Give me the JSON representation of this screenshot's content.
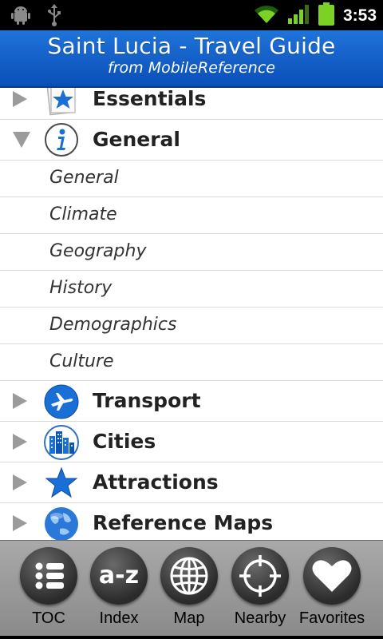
{
  "status_bar": {
    "time": "3:53",
    "icons": [
      "android-debug-icon",
      "usb-icon",
      "wifi-icon",
      "signal-icon",
      "battery-icon"
    ]
  },
  "header": {
    "title": "Saint Lucia - Travel Guide",
    "subtitle": "from MobileReference"
  },
  "toc": {
    "categories": [
      {
        "label": "Essentials",
        "icon": "star-document-icon",
        "expanded": false
      },
      {
        "label": "General",
        "icon": "info-icon",
        "expanded": true,
        "children": [
          "General",
          "Climate",
          "Geography",
          "History",
          "Demographics",
          "Culture"
        ]
      },
      {
        "label": "Transport",
        "icon": "airplane-icon",
        "expanded": false
      },
      {
        "label": "Cities",
        "icon": "city-buildings-icon",
        "expanded": false
      },
      {
        "label": "Attractions",
        "icon": "star-icon",
        "expanded": false
      },
      {
        "label": "Reference Maps",
        "icon": "globe-icon",
        "expanded": false
      }
    ]
  },
  "toolbar": {
    "items": [
      {
        "label": "TOC",
        "icon": "list-icon"
      },
      {
        "label": "Index",
        "icon": "a-z-icon"
      },
      {
        "label": "Map",
        "icon": "globe-grid-icon"
      },
      {
        "label": "Nearby",
        "icon": "crosshair-icon"
      },
      {
        "label": "Favorites",
        "icon": "heart-icon"
      }
    ]
  },
  "colors": {
    "header_blue": "#1565d0",
    "icon_blue": "#1a6fd6",
    "arrow_gray": "#9b9b9b"
  }
}
